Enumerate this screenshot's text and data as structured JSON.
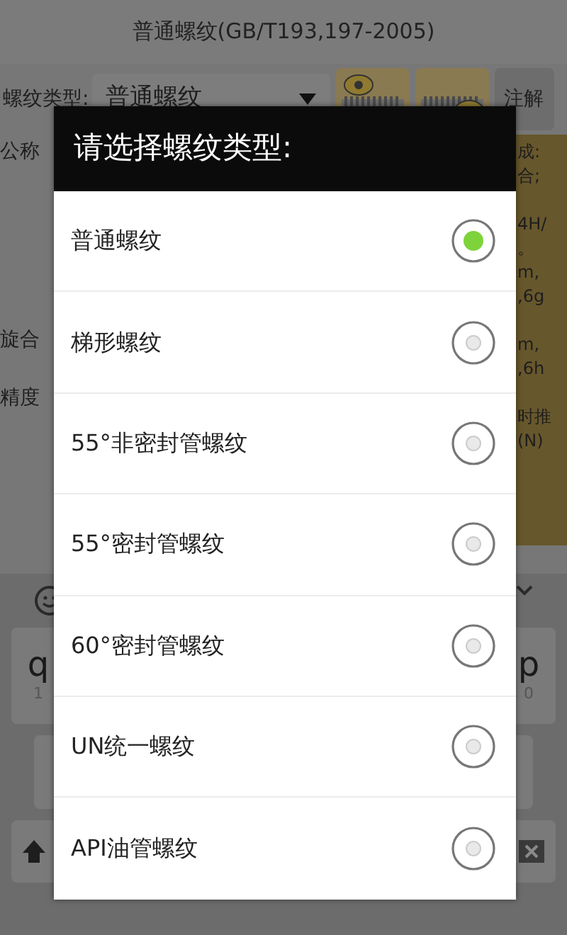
{
  "app": {
    "title": "普通螺纹(GB/T193,197-2005)",
    "type_label": "螺纹类型:",
    "type_value": "普通螺纹",
    "note_button": "注解",
    "labels": [
      "公称",
      "旋合",
      "精度"
    ],
    "panel_paragraphs": [
      [
        "成:",
        "合;"
      ],
      [
        "4H/",
        "。",
        "m,",
        ",6g"
      ],
      [
        "m,",
        ",6h"
      ],
      [
        "时推",
        "(N)"
      ]
    ]
  },
  "keyboard": {
    "keys": [
      {
        "letter": "q",
        "digit": "1"
      },
      {
        "letter": "p",
        "digit": "0"
      }
    ]
  },
  "dialog": {
    "title": "请选择螺纹类型:",
    "options": [
      {
        "label": "普通螺纹",
        "selected": true
      },
      {
        "label": "梯形螺纹",
        "selected": false
      },
      {
        "label": "55°非密封管螺纹",
        "selected": false
      },
      {
        "label": "55°密封管螺纹",
        "selected": false
      },
      {
        "label": "60°密封管螺纹",
        "selected": false
      },
      {
        "label": "UN统一螺纹",
        "selected": false
      },
      {
        "label": "API油管螺纹",
        "selected": false
      }
    ]
  }
}
